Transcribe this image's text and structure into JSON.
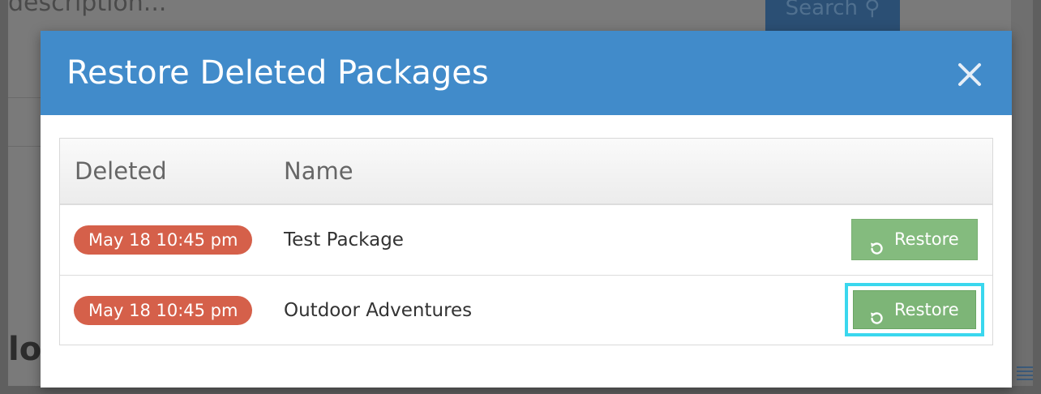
{
  "background": {
    "search_text": "description...",
    "search_button": "Search",
    "heading_fragment": "lo"
  },
  "modal": {
    "title": "Restore Deleted Packages",
    "close_label": "×",
    "header_color": "#418bca"
  },
  "table": {
    "columns": [
      "Deleted",
      "Name"
    ],
    "rows": [
      {
        "deleted": "May 18 10:45 pm",
        "name": "Test Package",
        "action": "Restore"
      },
      {
        "deleted": "May 18 10:45 pm",
        "name": "Outdoor Adventures",
        "action": "Restore"
      }
    ]
  },
  "colors": {
    "badge": "#d5604a",
    "restore_button": "#84bb7e",
    "highlight": "#3ad7ee"
  },
  "icons": {
    "close": "close-icon",
    "restore": "undo-icon",
    "search": "search-icon"
  }
}
